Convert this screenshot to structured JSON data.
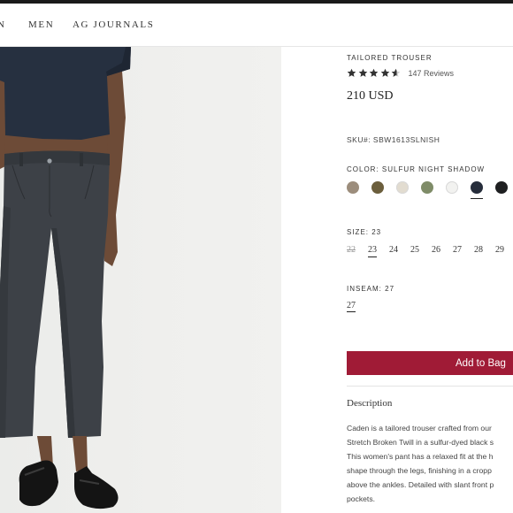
{
  "nav": {
    "items": [
      "N",
      "MEN",
      "AG JOURNALS"
    ]
  },
  "product": {
    "title": "TAILORED TROUSER",
    "rating": 4.6,
    "reviews_label": "147 Reviews",
    "price": "210 USD",
    "sku": "SKU#: SBW1613SLNISH",
    "color_label": "COLOR: SULFUR NIGHT SHADOW",
    "swatches": [
      {
        "color": "#9c8d7c"
      },
      {
        "color": "#6b5e3c"
      },
      {
        "color": "#e2dcd0"
      },
      {
        "color": "#7f8c68"
      },
      {
        "color": "#f2f2f0"
      },
      {
        "color": "#262d3b",
        "selected": true
      },
      {
        "color": "#1e1f21"
      }
    ],
    "size_label": "SIZE: 23",
    "sizes": [
      {
        "label": "22",
        "disabled": true
      },
      {
        "label": "23",
        "selected": true
      },
      {
        "label": "24"
      },
      {
        "label": "25"
      },
      {
        "label": "26"
      },
      {
        "label": "27"
      },
      {
        "label": "28"
      },
      {
        "label": "29"
      }
    ],
    "inseam_label": "INSEAM: 27",
    "inseam_value": "27",
    "add_to_bag": "Add to Bag",
    "description_heading": "Description",
    "description_lines": [
      "Caden is a tailored trouser crafted from our",
      "Stretch Broken Twill in a sulfur-dyed black s",
      "This women's pant has a relaxed fit at the h",
      "shape through the legs, finishing in a cropp",
      "above the ankles. Detailed with slant front p",
      "pockets."
    ]
  },
  "colors": {
    "accent": "#a01b36",
    "star": "#333333"
  }
}
